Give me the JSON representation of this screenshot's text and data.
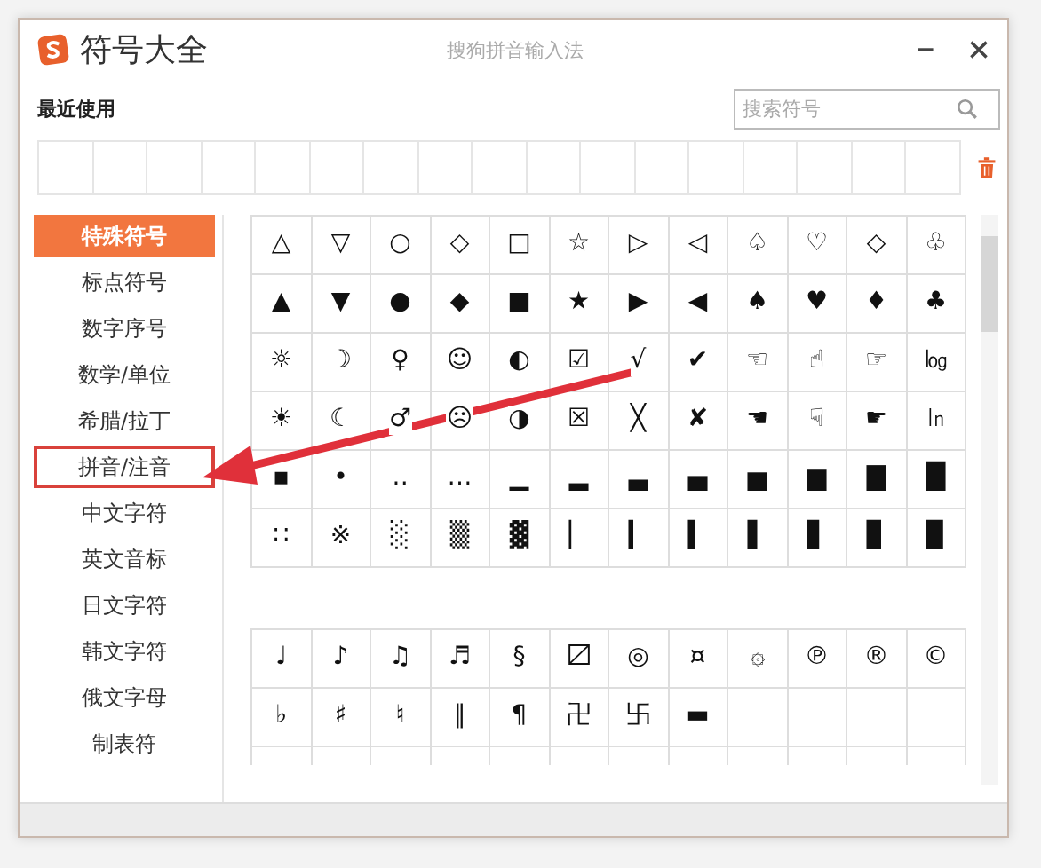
{
  "window": {
    "title": "符号大全",
    "subtitle": "搜狗拼音输入法"
  },
  "recent": {
    "label": "最近使用"
  },
  "search": {
    "placeholder": "搜索符号"
  },
  "categories": [
    {
      "label": "特殊符号",
      "selected": true,
      "highlighted": false
    },
    {
      "label": "标点符号",
      "selected": false,
      "highlighted": false
    },
    {
      "label": "数字序号",
      "selected": false,
      "highlighted": false
    },
    {
      "label": "数学/单位",
      "selected": false,
      "highlighted": false
    },
    {
      "label": "希腊/拉丁",
      "selected": false,
      "highlighted": false
    },
    {
      "label": "拼音/注音",
      "selected": false,
      "highlighted": true
    },
    {
      "label": "中文字符",
      "selected": false,
      "highlighted": false
    },
    {
      "label": "英文音标",
      "selected": false,
      "highlighted": false
    },
    {
      "label": "日文字符",
      "selected": false,
      "highlighted": false
    },
    {
      "label": "韩文字符",
      "selected": false,
      "highlighted": false
    },
    {
      "label": "俄文字母",
      "selected": false,
      "highlighted": false
    },
    {
      "label": "制表符",
      "selected": false,
      "highlighted": false
    }
  ],
  "symbol_groups": [
    {
      "rows": [
        [
          "△",
          "▽",
          "○",
          "◇",
          "□",
          "☆",
          "▷",
          "◁",
          "♤",
          "♡",
          "◇",
          "♧"
        ],
        [
          "▲",
          "▼",
          "●",
          "◆",
          "■",
          "★",
          "▶",
          "◀",
          "♠",
          "♥",
          "♦",
          "♣"
        ],
        [
          "☼",
          "☽",
          "♀",
          "☺",
          "◐",
          "☑",
          "√",
          "✔",
          "☜",
          "☝",
          "☞",
          "㏒"
        ],
        [
          "☀",
          "☾",
          "♂",
          "☹",
          "◑",
          "☒",
          "╳",
          "✘",
          "☚",
          "☟",
          "☛",
          "㏑"
        ],
        [
          "▪",
          "•",
          "‥",
          "…",
          "▁",
          "▂",
          "▃",
          "▄",
          "▅",
          "▆",
          "▇",
          "█"
        ],
        [
          "∷",
          "※",
          "░",
          "▒",
          "▓",
          "▏",
          "▎",
          "▍",
          "▌",
          "▋",
          "▊",
          "▉"
        ]
      ]
    },
    {
      "rows": [
        [
          "♩",
          "♪",
          "♫",
          "♬",
          "§",
          "〼",
          "◎",
          "¤",
          "۞",
          "℗",
          "®",
          "©"
        ],
        [
          "♭",
          "♯",
          "♮",
          "‖",
          "¶",
          "卍",
          "卐",
          "▬"
        ]
      ]
    }
  ],
  "annotation": {
    "kind": "arrow"
  }
}
